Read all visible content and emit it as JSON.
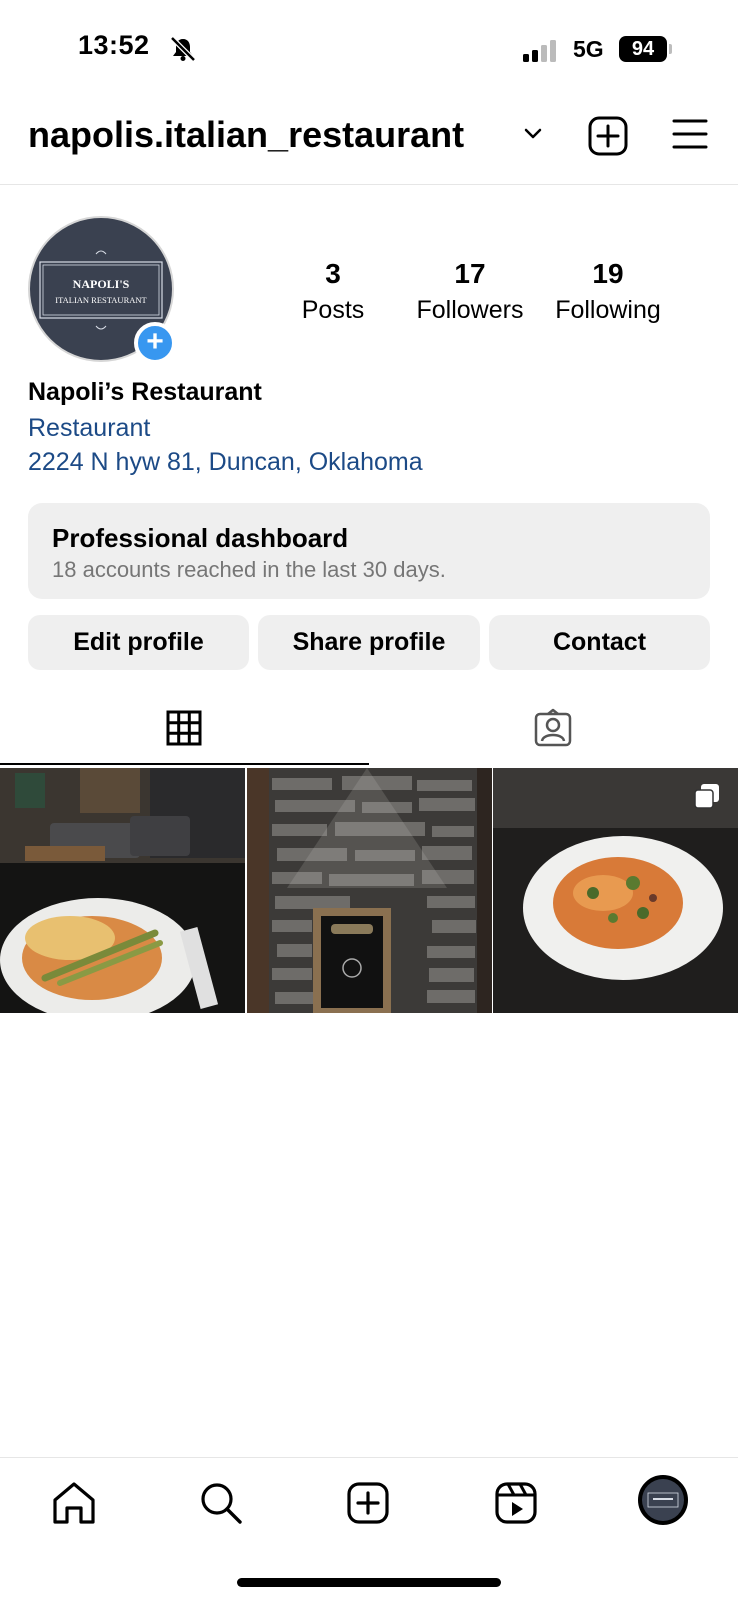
{
  "status_bar": {
    "time": "13:52",
    "network": "5G",
    "battery": "94"
  },
  "header": {
    "username": "napolis.italian_restaurant"
  },
  "avatar": {
    "logo_line1": "NAPOLI'S",
    "logo_line2": "ITALIAN RESTAURANT"
  },
  "stats": [
    {
      "value": "3",
      "label": "Posts"
    },
    {
      "value": "17",
      "label": "Followers"
    },
    {
      "value": "19",
      "label": "Following"
    }
  ],
  "bio": {
    "display_name": "Napoli’s Restaurant",
    "category": "Restaurant",
    "address": "2224 N hyw 81, Duncan, Oklahoma"
  },
  "dashboard": {
    "title": "Professional dashboard",
    "subtitle": "18 accounts reached in the last 30 days."
  },
  "buttons": {
    "edit": "Edit profile",
    "share": "Share profile",
    "contact": "Contact"
  },
  "tabs": {
    "active": "grid",
    "items": [
      "grid-icon",
      "tagged-icon"
    ]
  },
  "posts": [
    {
      "name": "post-restaurant-interior-pasta",
      "multi": false
    },
    {
      "name": "post-stone-wall-sign",
      "multi": false
    },
    {
      "name": "post-penne-plate",
      "multi": true
    }
  ],
  "nav": [
    "home-icon",
    "search-icon",
    "create-icon",
    "reels-icon",
    "profile-avatar"
  ],
  "colors": {
    "link_blue": "#1c4a86",
    "plus_badge": "#3897f0",
    "button_bg": "#efefef"
  }
}
